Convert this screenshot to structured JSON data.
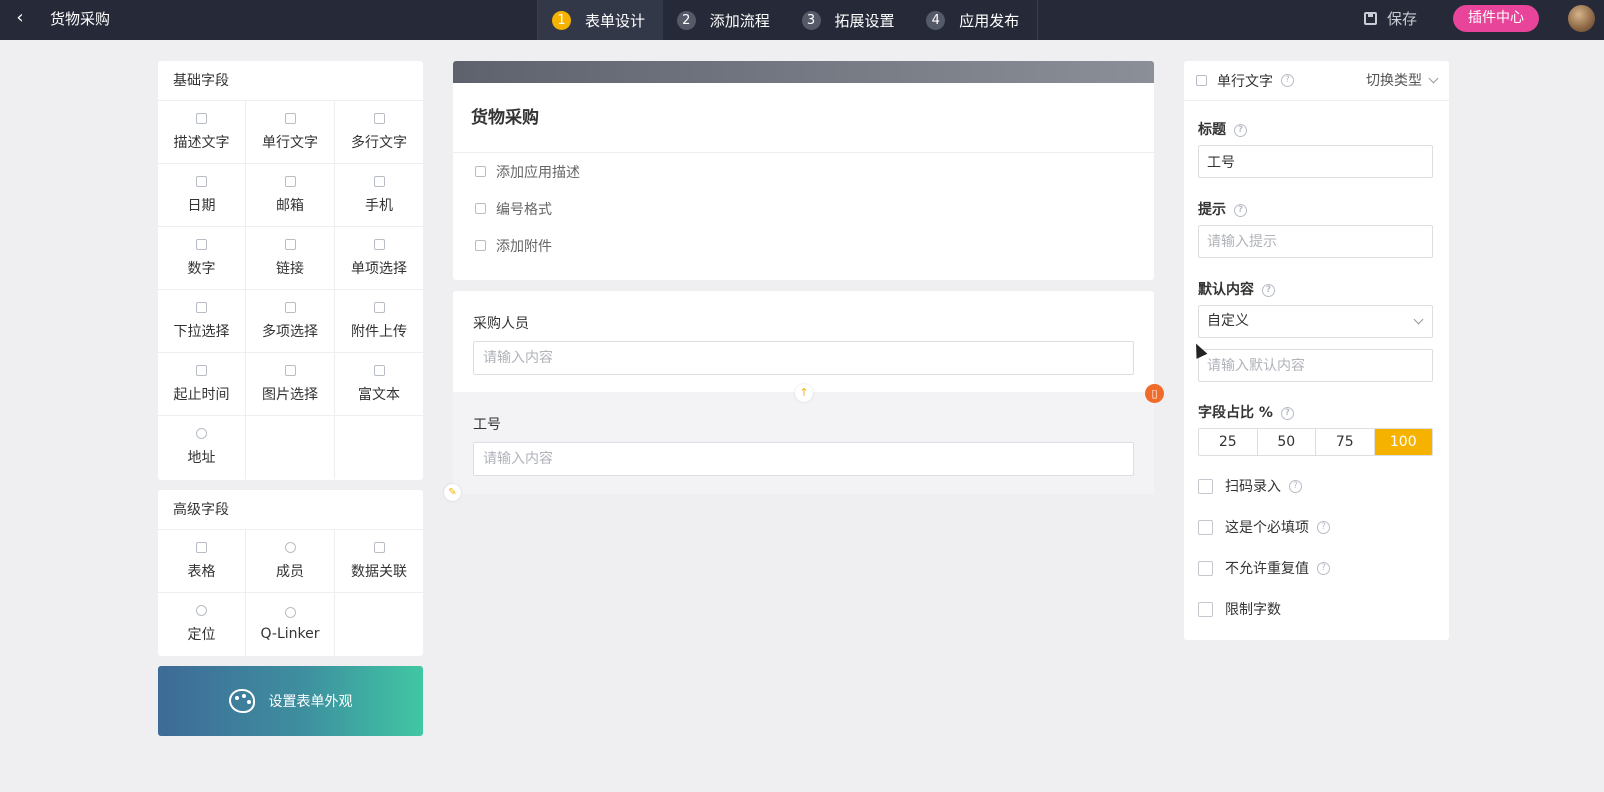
{
  "topbar": {
    "back_icon": "chevron-left-icon",
    "title": "货物采购",
    "steps": [
      {
        "num": "1",
        "label": "表单设计"
      },
      {
        "num": "2",
        "label": "添加流程"
      },
      {
        "num": "3",
        "label": "拓展设置"
      },
      {
        "num": "4",
        "label": "应用发布"
      }
    ],
    "save_label": "保存",
    "plugin_label": "插件中心",
    "accent": "#f5b300",
    "plugin_color": "#e8459a"
  },
  "basic_fields": {
    "title": "基础字段",
    "items": [
      "描述文字",
      "单行文字",
      "多行文字",
      "日期",
      "邮箱",
      "手机",
      "数字",
      "链接",
      "单项选择",
      "下拉选择",
      "多项选择",
      "附件上传",
      "起止时间",
      "图片选择",
      "富文本",
      "地址"
    ]
  },
  "advanced_fields": {
    "title": "高级字段",
    "items": [
      "表格",
      "成员",
      "数据关联",
      "定位",
      "Q-Linker"
    ]
  },
  "appearance_label": "设置表单外观",
  "form": {
    "name": "货物采购",
    "options": [
      "添加应用描述",
      "编号格式",
      "添加附件"
    ],
    "fields": [
      {
        "label": "采购人员",
        "placeholder": "请输入内容"
      },
      {
        "label": "工号",
        "placeholder": "请输入内容"
      }
    ]
  },
  "props": {
    "type_name": "单行文字",
    "switch_type": "切换类型",
    "title_label": "标题",
    "title_value": "工号",
    "hint_label": "提示",
    "hint_placeholder": "请输入提示",
    "default_label": "默认内容",
    "default_mode": "自定义",
    "default_placeholder": "请输入默认内容",
    "ratio_label": "字段占比 %",
    "ratio_options": [
      "25",
      "50",
      "75",
      "100"
    ],
    "ratio_selected": "100",
    "checkboxes": [
      "扫码录入",
      "这是个必填项",
      "不允许重复值",
      "限制字数"
    ]
  }
}
